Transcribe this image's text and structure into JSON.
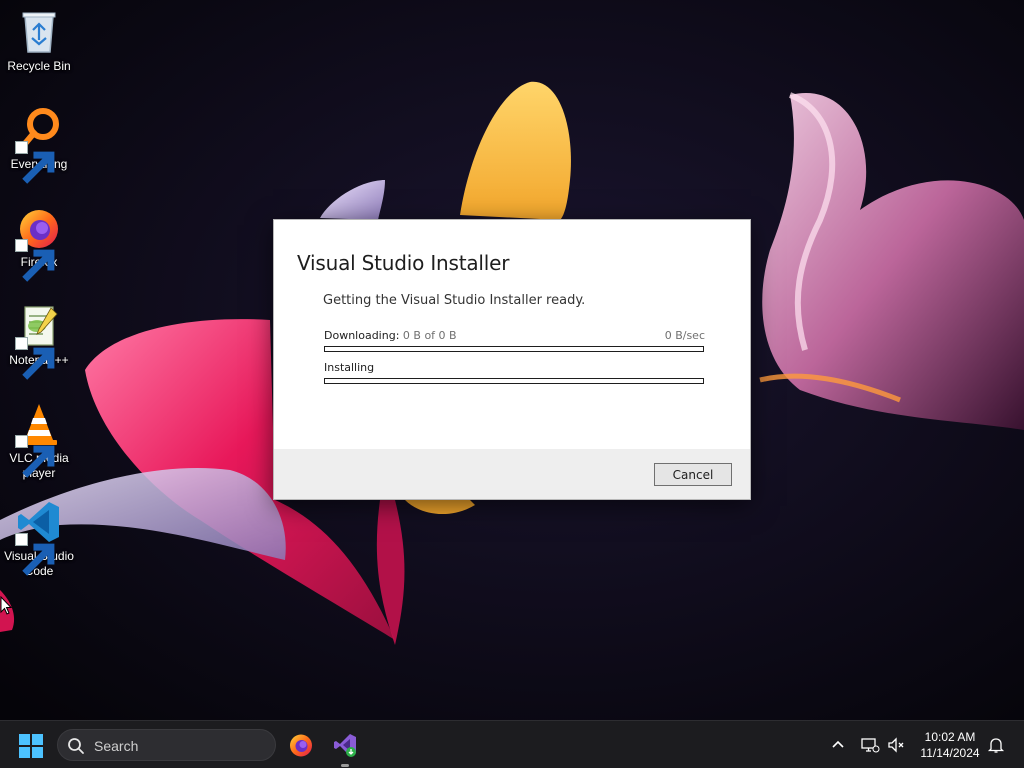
{
  "desktop": {
    "icons": [
      {
        "label": "Recycle Bin"
      },
      {
        "label": "Everything"
      },
      {
        "label": "Firefox"
      },
      {
        "label": "Notepad++"
      },
      {
        "label": "VLC media player"
      },
      {
        "label": "Visual Studio Code"
      }
    ]
  },
  "installer": {
    "title": "Visual Studio Installer",
    "status": "Getting the Visual Studio Installer ready.",
    "download": {
      "label": "Downloading:",
      "detail": "0 B of 0 B",
      "rate": "0 B/sec",
      "progress": 0
    },
    "install": {
      "label": "Installing",
      "progress": 0
    },
    "cancel_label": "Cancel"
  },
  "taskbar": {
    "search_label": "Search",
    "pinned_apps": [
      "firefox-icon",
      "visual-studio-installer-icon"
    ],
    "clock": {
      "time": "10:02 AM",
      "date": "11/14/2024"
    }
  },
  "colors": {
    "accent": "#0078d4",
    "vs_purple": "#6a3fb5",
    "taskbar": "#1c1c1f"
  }
}
